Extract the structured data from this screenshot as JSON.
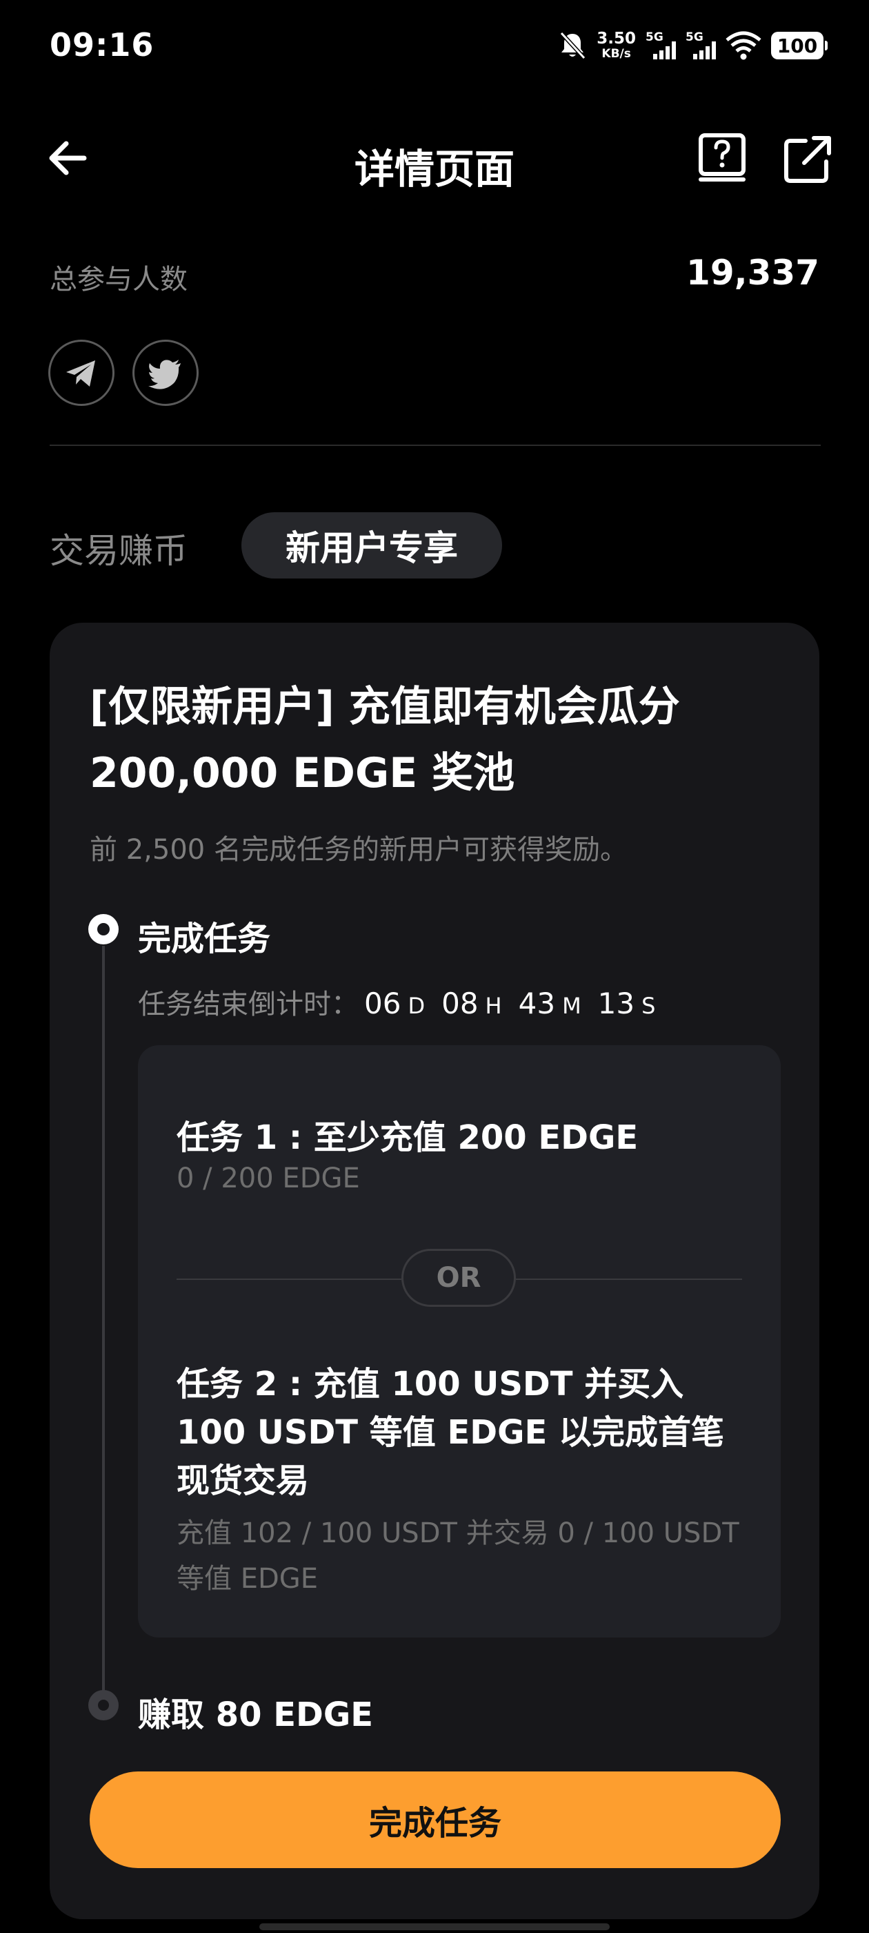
{
  "status_bar": {
    "time": "09:16",
    "net_speed_value": "3.50",
    "net_speed_unit": "KB/s",
    "signal1_label": "5G",
    "signal2_label": "5G",
    "battery": "100"
  },
  "header": {
    "title": "详情页面",
    "back_icon": "arrow-left-icon",
    "help_icon": "help-book-icon",
    "share_icon": "external-share-icon"
  },
  "stats": {
    "participants_label": "总参与人数",
    "participants_value": "19,337"
  },
  "social": [
    "telegram-icon",
    "twitter-icon"
  ],
  "tabs": {
    "earn": "交易赚币",
    "new_user": "新用户专享"
  },
  "campaign": {
    "title": "[仅限新用户] 充值即有机会瓜分 200,000 EDGE 奖池",
    "subtitle": "前 2,500 名完成任务的新用户可获得奖励。"
  },
  "step1": {
    "title": "完成任务",
    "countdown_label": "任务结束倒计时：",
    "countdown": {
      "days": "06",
      "days_unit": "D",
      "hours": "08",
      "hours_unit": "H",
      "minutes": "43",
      "minutes_unit": "M",
      "seconds": "13",
      "seconds_unit": "S"
    }
  },
  "tasks": {
    "task1_title": "任务 1 : 至少充值 200 EDGE",
    "task1_progress": "0 / 200 EDGE",
    "or_label": "OR",
    "task2_title": "任务 2 : 充值 100 USDT 并买入 100 USDT 等值 EDGE 以完成首笔现货交易",
    "task2_progress": "充值 102 / 100 USDT 并交易 0 / 100 USDT 等值 EDGE"
  },
  "step2": {
    "title": "赚取 80 EDGE"
  },
  "cta": {
    "label": "完成任务"
  },
  "colors": {
    "accent": "#fd9e2f",
    "card": "#17171a",
    "task_box": "#202126"
  }
}
